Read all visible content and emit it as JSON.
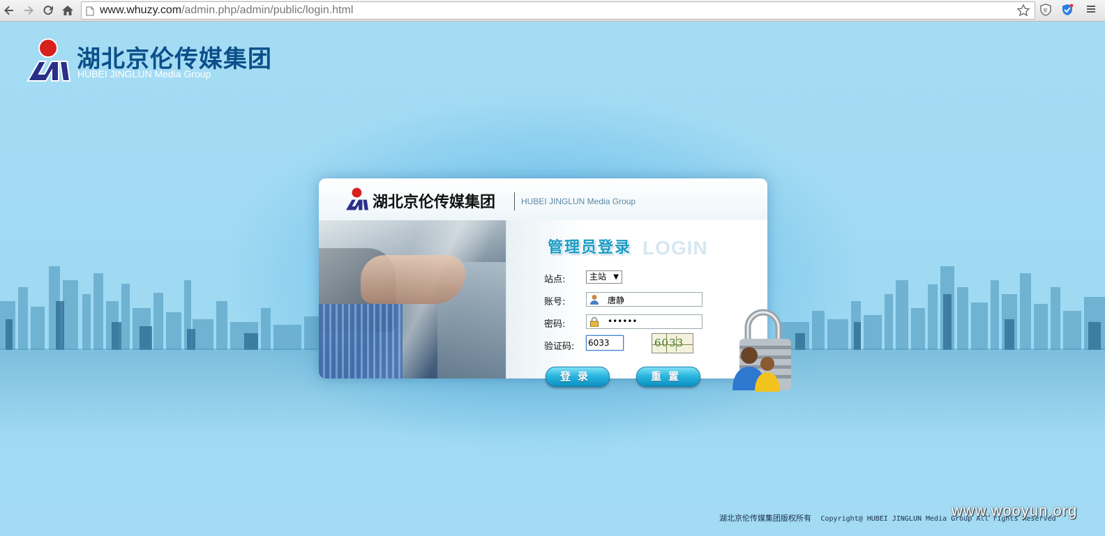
{
  "browser": {
    "url_host": "www.whuzy.com",
    "url_path": "/admin.php/admin/public/login.html"
  },
  "brand": {
    "name_cn": "湖北京伦传媒集团",
    "name_en": "HUBEI JINGLUN Media Group",
    "logo_color_red": "#d8201d",
    "logo_color_blue": "#2a2f8a"
  },
  "login": {
    "title": "管理员登录",
    "title_watermark": "LOGIN",
    "site_label": "站点:",
    "site_selected": "主站",
    "account_label": "账号:",
    "account_value": "唐静",
    "password_label": "密码:",
    "password_value": "••••••",
    "captcha_label": "验证码:",
    "captcha_value": "6033",
    "captcha_image_text": "6033",
    "login_button": "登录",
    "reset_button": "重置"
  },
  "footer": {
    "copyright_cn": "湖北京伦传媒集团版权所有",
    "copyright_en": "Copyright@ HUBEI JINGLUN Media Group All rights Reserved"
  },
  "watermark": "www.wooyun.org",
  "colors": {
    "background": "#a4dcf3",
    "button": "#2bb7e0",
    "title": "#1a9cc4"
  }
}
